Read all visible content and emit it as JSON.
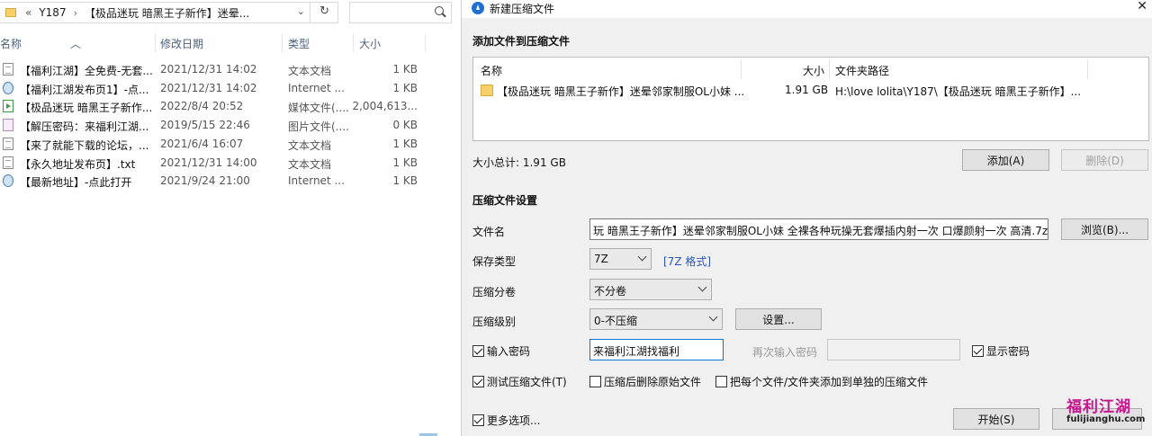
{
  "explorer": {
    "address": {
      "chevrons": "«",
      "crumb1": "Y187",
      "sep": "›",
      "crumb2": "【极品迷玩 暗黑王子新作】迷晕..."
    },
    "columns": {
      "name": "名称",
      "date": "修改日期",
      "type": "类型",
      "size": "大小"
    },
    "files": [
      {
        "icon": "text-file-icon",
        "name": "【福利江湖】全免费-无套...",
        "date": "2021/12/31 14:02",
        "type": "文本文档",
        "size": "1 KB"
      },
      {
        "icon": "internet-shortcut-icon",
        "name": "【福利江湖发布页1】-点...",
        "date": "2021/12/31 14:02",
        "type": "Internet ...",
        "size": "1 KB"
      },
      {
        "icon": "video-file-icon",
        "name": "【极品迷玩 暗黑王子新作...",
        "date": "2022/8/4 20:52",
        "type": "媒体文件(....",
        "size": "2,004,613..."
      },
      {
        "icon": "image-file-icon",
        "name": "【解压密码：来福利江湖...",
        "date": "2019/5/15 22:46",
        "type": "图片文件(....",
        "size": "0 KB"
      },
      {
        "icon": "text-file-icon",
        "name": "【来了就能下载的论坛，...",
        "date": "2021/6/4 16:07",
        "type": "文本文档",
        "size": "1 KB"
      },
      {
        "icon": "text-file-icon",
        "name": "【永久地址发布页】.txt",
        "date": "2021/12/31 14:00",
        "type": "文本文档",
        "size": "1 KB"
      },
      {
        "icon": "internet-shortcut-icon",
        "name": "【最新地址】-点此打开",
        "date": "2021/9/24 21:00",
        "type": "Internet ...",
        "size": "1 KB"
      }
    ]
  },
  "dialog": {
    "title": "新建压缩文件",
    "add_section": "添加文件到压缩文件",
    "list": {
      "headers": {
        "name": "名称",
        "size": "大小",
        "path": "文件夹路径"
      },
      "row": {
        "name": "【极品迷玩 暗黑王子新作】迷晕邻家制服OL小妹 ...",
        "size": "1.91 GB",
        "path": "H:\\love lolita\\Y187\\【极品迷玩 暗黑王子新作】..."
      }
    },
    "total_size": "大小总计: 1.91 GB",
    "add_button": "添加(A)",
    "delete_button": "删除(D)",
    "settings_section": "压缩文件设置",
    "filename_label": "文件名",
    "filename_value": "玩 暗黑王子新作】迷晕邻家制服OL小妹 全裸各种玩操无套爆插内射一次 口爆颜射一次 高清.7z",
    "browse_button": "浏览(B)...",
    "save_type_label": "保存类型",
    "save_type_value": "7Z",
    "format_link": "[7Z 格式]",
    "split_label": "压缩分卷",
    "split_value": "不分卷",
    "level_label": "压缩级别",
    "level_value": "0-不压缩",
    "settings_button": "设置...",
    "password_checkbox": "输入密码",
    "password_value": "来福利江湖找福利",
    "reenter_label": "再次输入密码",
    "show_password": "显示密码",
    "test_checkbox": "测试压缩文件(T)",
    "delete_after": "压缩后删除原始文件",
    "each_separate": "把每个文件/文件夹添加到单独的压缩文件",
    "more_options": "更多选项...",
    "start_button": "开始(S)",
    "close_glyph": "✕"
  },
  "watermark": {
    "text": "福利江湖",
    "url": "fulijianghu.com"
  }
}
